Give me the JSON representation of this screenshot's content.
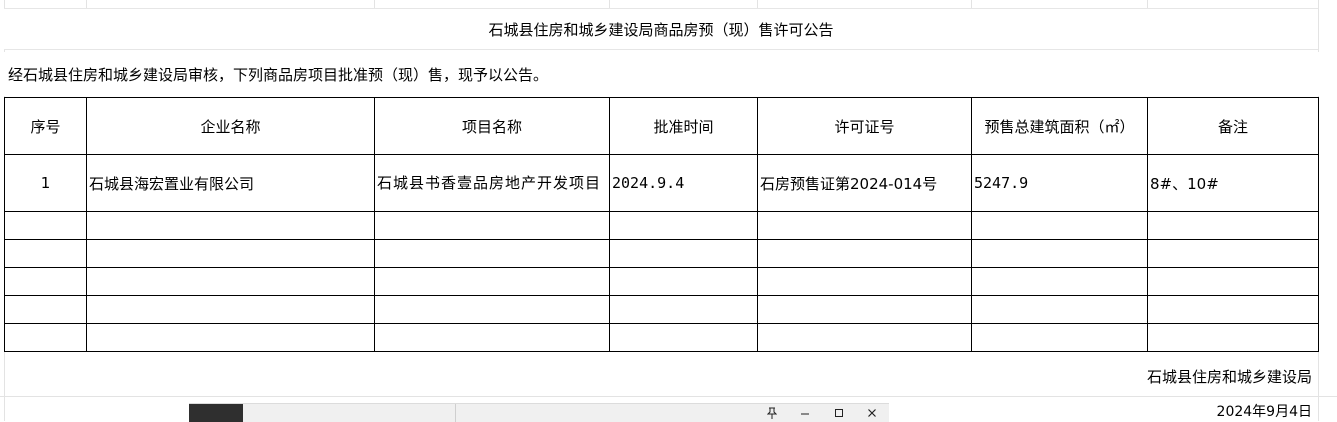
{
  "notice": {
    "title": "石城县住房和城乡建设局商品房预（现）售许可公告",
    "intro": "经石城县住房和城乡建设局审核，下列商品房项目批准预（现）售，现予以公告。",
    "table": {
      "headers": [
        "序号",
        "企业名称",
        "项目名称",
        "批准时间",
        "许可证号",
        "预售总建筑面积（㎡）",
        "备注"
      ],
      "rows": [
        {
          "no": "1",
          "company": "石城县海宏置业有限公司",
          "project": "石城县书香壹品房地产开发项目",
          "approval_date": "2024.9.4",
          "permit_no": "石房预售证第2024-014号",
          "area": "5247.9",
          "remarks": "8#、10#"
        }
      ]
    },
    "issuer": "石城县住房和城乡建设局",
    "date": "2024年9月4日"
  },
  "window_controls": {
    "pin_icon": "pin-icon",
    "minimize_icon": "minimize-icon",
    "maximize_icon": "maximize-icon",
    "close_icon": "close-icon"
  }
}
